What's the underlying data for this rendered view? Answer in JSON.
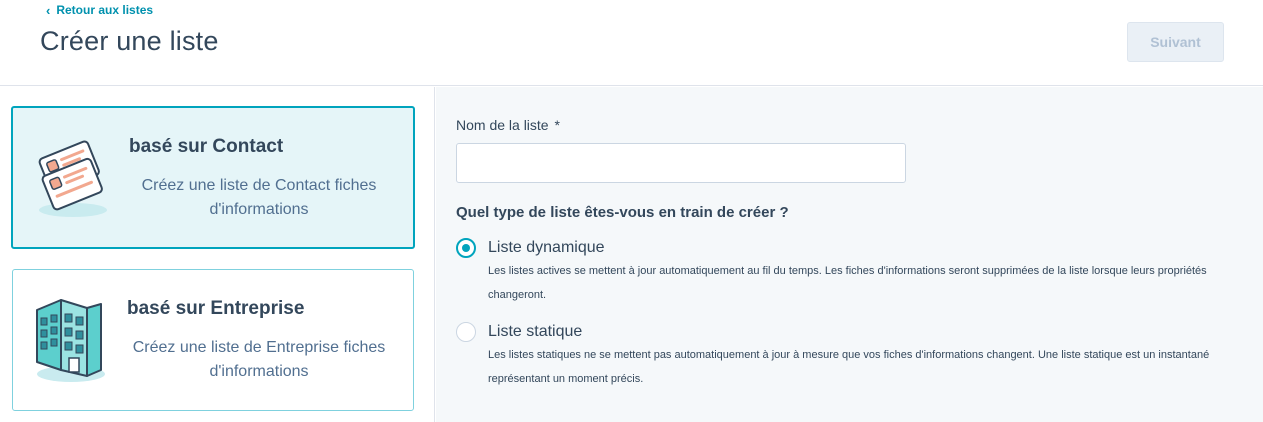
{
  "header": {
    "back_link": "Retour aux listes",
    "title": "Créer une liste",
    "next_button": "Suivant"
  },
  "cards": {
    "contact": {
      "title": "basé sur Contact",
      "description": "Créez une liste de Contact  fiches d'informations",
      "selected": true,
      "icon": "contact-cards-icon"
    },
    "company": {
      "title": "basé sur Entreprise",
      "description": "Créez une liste de Entreprise  fiches d'informations",
      "selected": false,
      "icon": "building-icon"
    }
  },
  "form": {
    "name_label": "Nom de la liste",
    "required_mark": "*",
    "name_value": "",
    "name_placeholder": "",
    "type_question": "Quel type de liste êtes-vous en train de créer ?",
    "options": [
      {
        "label": "Liste dynamique",
        "help": "Les listes actives se mettent à jour automatiquement au fil du temps. Les fiches d'informations seront supprimées de la liste lorsque leurs propriétés changeront.",
        "checked": true
      },
      {
        "label": "Liste statique",
        "help": "Les listes statiques ne se mettent pas automatiquement à jour à mesure que vos fiches d'informations changent. Une liste statique est un instantané représentant un moment précis.",
        "checked": false
      }
    ]
  },
  "colors": {
    "accent": "#00a4bd",
    "link": "#0091ae",
    "text": "#33475b",
    "disabled_button_bg": "#eaf0f6",
    "disabled_button_text": "#b0c1d4"
  }
}
